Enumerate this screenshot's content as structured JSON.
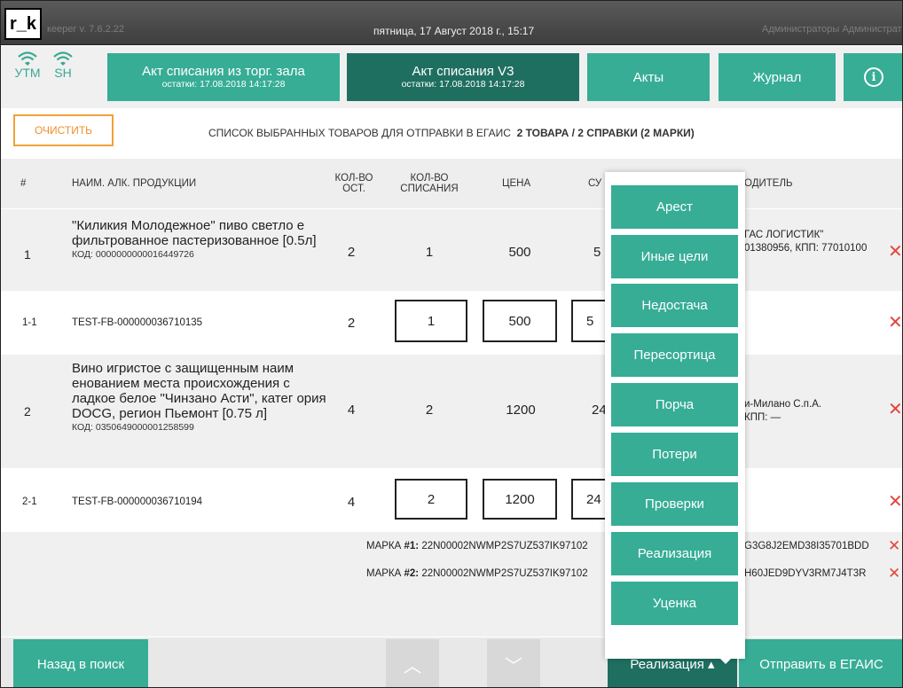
{
  "topbar": {
    "logo": "r_k",
    "version": "кеерег v. 7.6.2.22",
    "datetime": "пятница, 17 Август 2018 г., 15:17",
    "user": "Администраторы Администрат"
  },
  "connections": [
    {
      "label": "УТМ"
    },
    {
      "label": "SH"
    }
  ],
  "header_buttons": {
    "act_shop": {
      "title": "Акт списания из торг. зала",
      "sub": "остатки: 17.08.2018 14:17:28"
    },
    "act_v3": {
      "title": "Акт списания V3",
      "sub": "остатки: 17.08.2018 14:17:28"
    },
    "acts": "Акты",
    "journal": "Журнал",
    "info_glyph": "i"
  },
  "clear_label": "ОЧИСТИТЬ",
  "list_title": {
    "prefix": "СПИСОК ВЫБРАННЫХ ТОВАРОВ ДЛЯ ОТПРАВКИ В ЕГАИС",
    "summary": "2 ТОВАРА / 2 СПРАВКИ (2 МАРКИ)"
  },
  "columns": {
    "num": "#",
    "name": "НАИМ. АЛК. ПРОДУКЦИИ",
    "qty_left": "КОЛ-ВО ОСТ.",
    "qty_write": "КОЛ-ВО СПИСАНИЯ",
    "price": "ЦЕНА",
    "sum": "СУ",
    "producer": "ОДИТЕЛЬ"
  },
  "rows": [
    {
      "num": "1",
      "name": "\"Киликия Молодежное\" пиво светло е фильтрованное пастеризованное [0.5л]",
      "code": "КОД: 0000000000016449726",
      "qty_left": "2",
      "qty_write": "1",
      "price": "500",
      "sum": "5",
      "producer": "ГАС ЛОГИСТИК\"",
      "producer2": "01380956, КПП: 77010100"
    },
    {
      "num": "1-1",
      "ref": "TEST-FB-000000036710135",
      "qty_left": "2",
      "qty_write": "1",
      "price": "500",
      "sum": "5"
    },
    {
      "num": "2",
      "name": "Вино игристое с защищенным наим енованием места происхождения с ладкое белое \"Чинзано Асти\", катег ория DOCG, регион Пьемонт [0.75 л]",
      "code": "КОД: 0350649000001258599",
      "qty_left": "4",
      "qty_write": "2",
      "price": "1200",
      "sum": "24",
      "producer": "и-Милано С.п.А.",
      "producer2": "КПП: —"
    },
    {
      "num": "2-1",
      "ref": "TEST-FB-000000036710194",
      "qty_left": "4",
      "qty_write": "2",
      "price": "1200",
      "sum": "24"
    }
  ],
  "marks": [
    {
      "prefix": "МАРКА",
      "num": "#1:",
      "value": "22N00002NWMP2S7UZ537IK97102",
      "tail": "G3G8J2EMD38I35701BDD"
    },
    {
      "prefix": "МАРКА",
      "num": "#2:",
      "value": "22N00002NWMP2S7UZ537IK97102",
      "tail": "H60JED9DYV3RM7J4T3R"
    }
  ],
  "delete_glyph": "✕",
  "menu_items": [
    "Арест",
    "Иные цели",
    "Недостача",
    "Пересортица",
    "Порча",
    "Потери",
    "Проверки",
    "Реализация",
    "Уценка"
  ],
  "footer": {
    "back": "Назад в поиск",
    "up_glyph": "︿",
    "down_glyph": "﹀",
    "reason": "Реализация ▴",
    "send": "Отправить в ЕГАИС"
  },
  "colors": {
    "accent": "#37ad96",
    "accent_dark": "#1f6f61",
    "warning": "#f08f2a",
    "delete": "#e2463c"
  }
}
